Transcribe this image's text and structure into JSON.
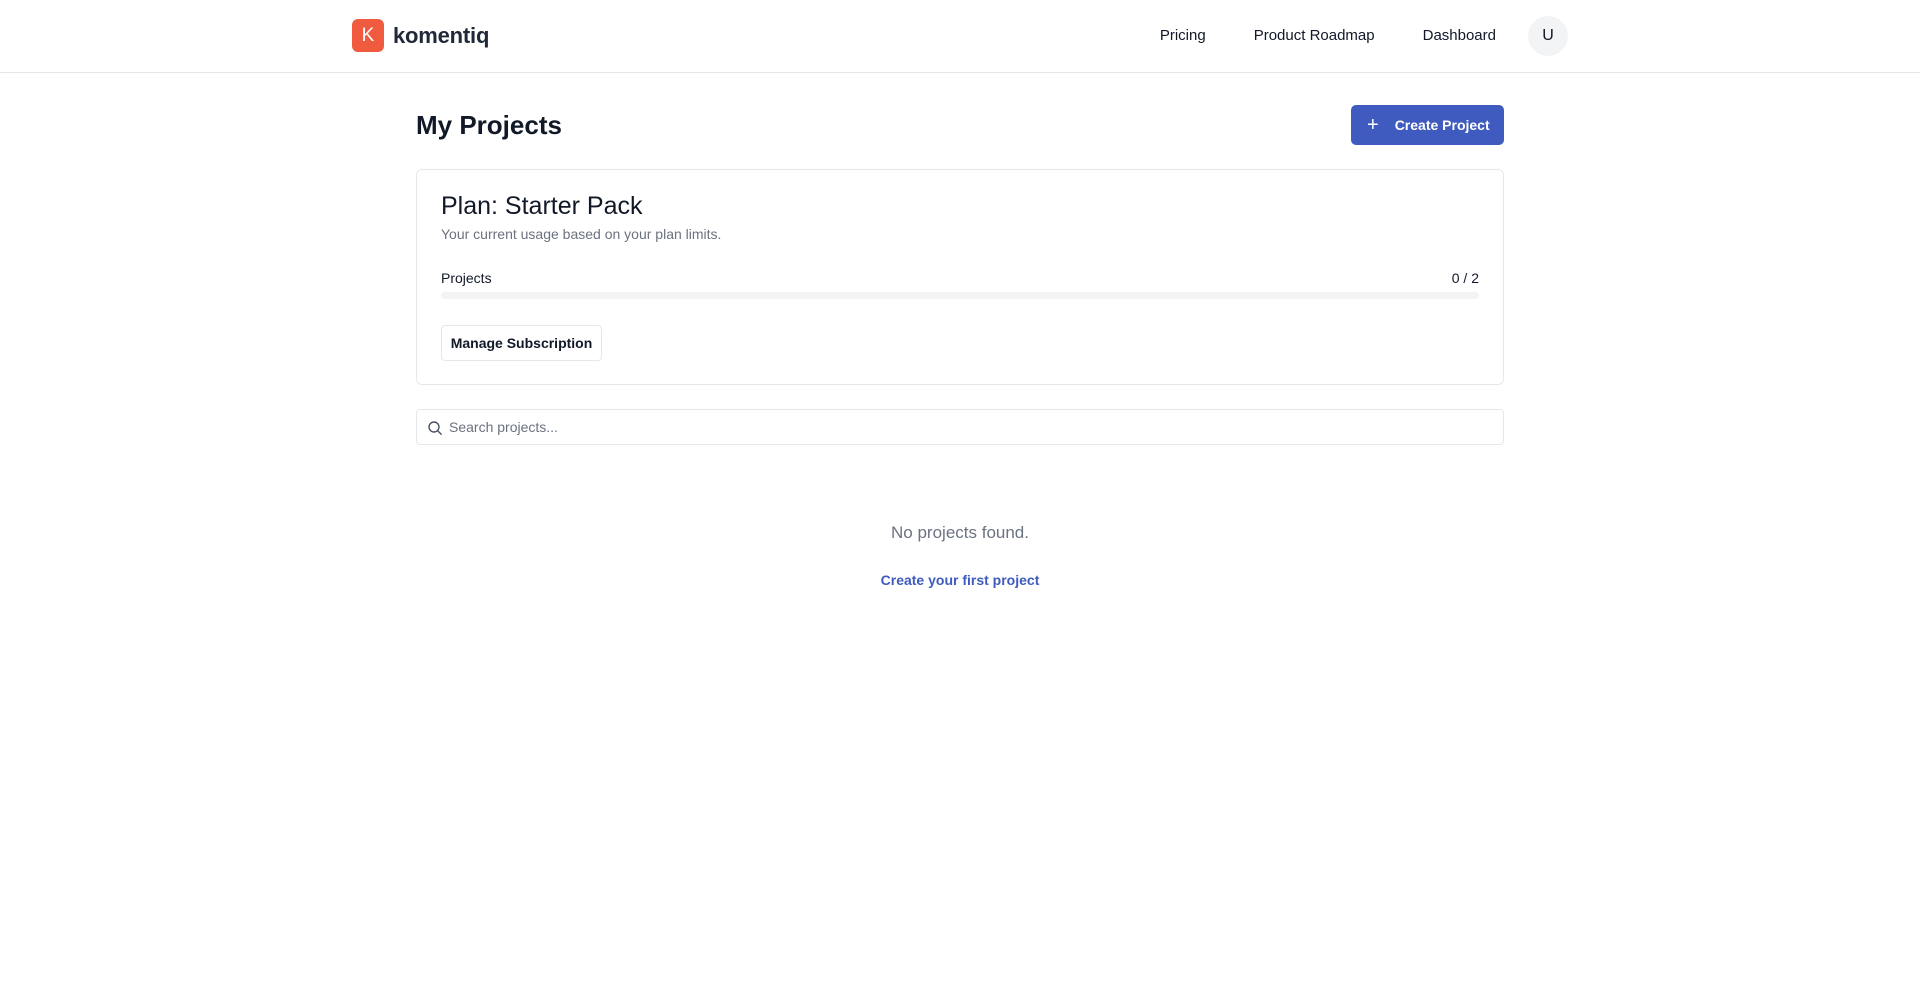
{
  "brand": {
    "mark": "K",
    "name": "komentiq",
    "color": "#f05a3e"
  },
  "nav": {
    "pricing": "Pricing",
    "roadmap": "Product Roadmap",
    "dashboard": "Dashboard",
    "avatar": "U"
  },
  "header": {
    "title": "My Projects",
    "create_button": "Create Project",
    "create_icon": "plus-icon"
  },
  "plan": {
    "title": "Plan: Starter Pack",
    "subtitle": "Your current usage based on your plan limits.",
    "usage_label": "Projects",
    "usage_count": "0 / 2",
    "usage_used": 0,
    "usage_limit": 2,
    "usage_fraction": 0,
    "manage_button": "Manage Subscription"
  },
  "search": {
    "placeholder": "Search projects...",
    "value": "",
    "icon": "search-icon"
  },
  "empty": {
    "message": "No projects found.",
    "link": "Create your first project"
  },
  "colors": {
    "accent": "#3f5bbf",
    "brand": "#f05a3e",
    "muted_text": "#6b7280",
    "border": "#e5e7eb"
  }
}
